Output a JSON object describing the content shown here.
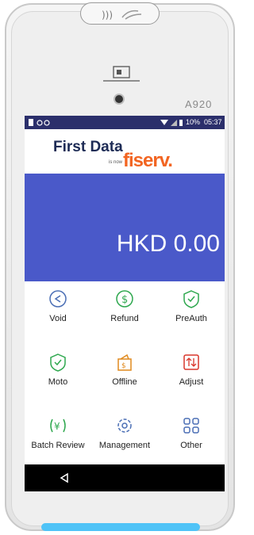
{
  "device": {
    "model": "A920"
  },
  "status_bar": {
    "battery": "10%",
    "time": "05:37"
  },
  "brand": {
    "name": "First Data",
    "tagline": "is now",
    "new_name": "fiserv."
  },
  "transaction": {
    "amount": "HKD 0.00"
  },
  "menu": [
    {
      "label": "Void",
      "icon": "void-icon",
      "color": "#4b6fb5"
    },
    {
      "label": "Refund",
      "icon": "refund-icon",
      "color": "#2fa84f"
    },
    {
      "label": "PreAuth",
      "icon": "preauth-icon",
      "color": "#2fa84f"
    },
    {
      "label": "Moto",
      "icon": "moto-icon",
      "color": "#2fa84f"
    },
    {
      "label": "Offline",
      "icon": "offline-icon",
      "color": "#e08a1e"
    },
    {
      "label": "Adjust",
      "icon": "adjust-icon",
      "color": "#d9362b"
    },
    {
      "label": "Batch Review",
      "icon": "batch-review-icon",
      "color": "#2fa84f"
    },
    {
      "label": "Management",
      "icon": "management-icon",
      "color": "#4b6fb5"
    },
    {
      "label": "Other",
      "icon": "other-icon",
      "color": "#4b6fb5"
    }
  ],
  "nav": {
    "back": "back-icon"
  }
}
